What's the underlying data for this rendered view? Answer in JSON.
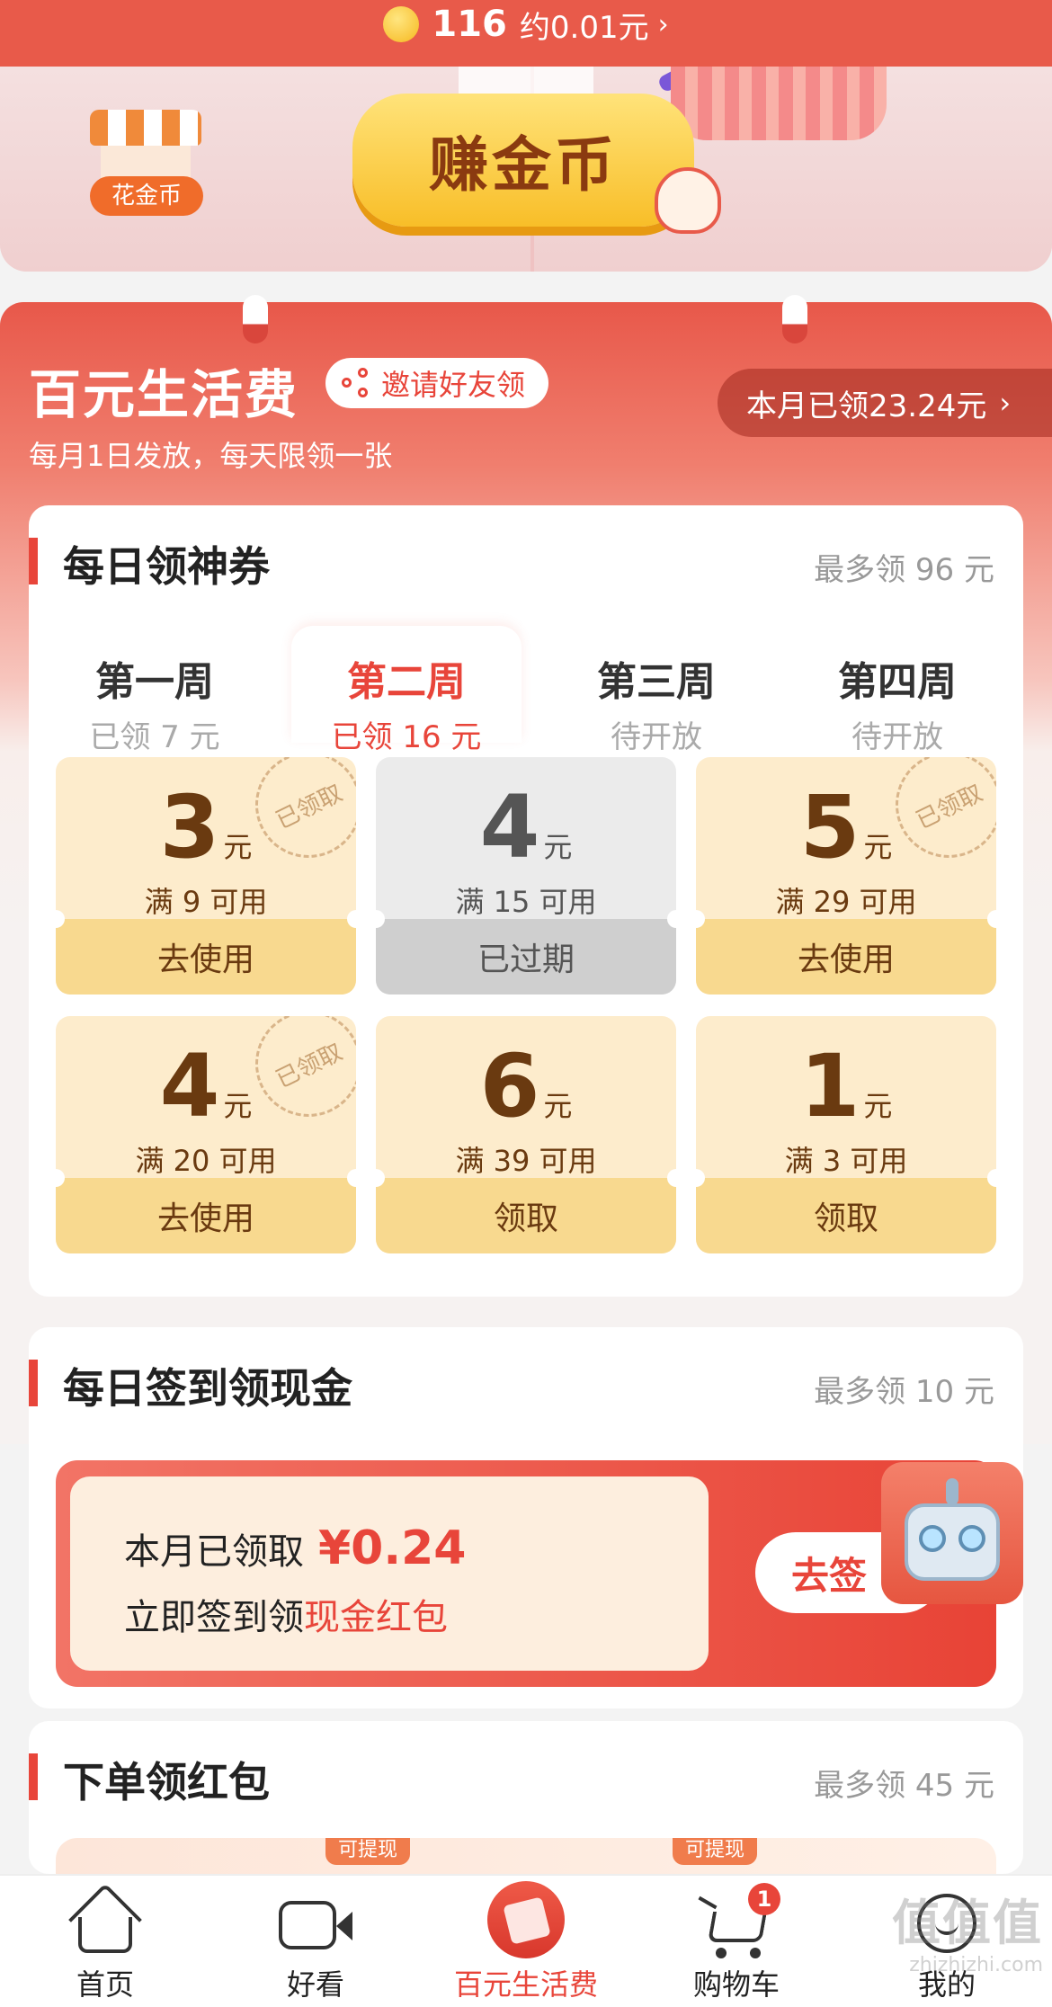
{
  "top_bar": {
    "coin_count": "116",
    "coin_approx": "约0.01元",
    "chevron": "›"
  },
  "banner": {
    "shop_label": "花金币",
    "earn_button": "赚金币",
    "hand_icon": "pointing-hand-icon"
  },
  "allowance": {
    "title": "百元生活费",
    "invite_label": "邀请好友领",
    "subtitle": "每月1日发放，每天限领一张",
    "month_claimed": "本月已领23.24元",
    "month_chevron": "›"
  },
  "daily_coupon": {
    "title": "每日领神券",
    "max": "最多领 96 元",
    "tabs": [
      {
        "name": "第一周",
        "sub": "已领 7 元",
        "active": false
      },
      {
        "name": "第二周",
        "sub": "已领 16 元",
        "active": true
      },
      {
        "name": "第三周",
        "sub": "待开放",
        "active": false
      },
      {
        "name": "第四周",
        "sub": "待开放",
        "active": false
      }
    ],
    "coupons": [
      {
        "amount": "3",
        "unit": "元",
        "cond": "满 9 可用",
        "button": "去使用",
        "stamp": "已领取",
        "state": "claimed"
      },
      {
        "amount": "4",
        "unit": "元",
        "cond": "满 15 可用",
        "button": "已过期",
        "stamp": "",
        "state": "expired"
      },
      {
        "amount": "5",
        "unit": "元",
        "cond": "满 29 可用",
        "button": "去使用",
        "stamp": "已领取",
        "state": "claimed"
      },
      {
        "amount": "4",
        "unit": "元",
        "cond": "满 20 可用",
        "button": "去使用",
        "stamp": "已领取",
        "state": "claimed"
      },
      {
        "amount": "6",
        "unit": "元",
        "cond": "满 39 可用",
        "button": "领取",
        "stamp": "",
        "state": "available"
      },
      {
        "amount": "1",
        "unit": "元",
        "cond": "满 3 可用",
        "button": "领取",
        "stamp": "",
        "state": "available"
      }
    ]
  },
  "signin": {
    "title": "每日签到领现金",
    "max": "最多领 10 元",
    "month_label": "本月已领取",
    "month_amount": "¥0.24",
    "line2_prefix": "立即签到领",
    "line2_highlight": "现金红包",
    "button": "去签"
  },
  "order": {
    "title": "下单领红包",
    "max": "最多领 45 元",
    "tag": "可提现"
  },
  "bottom_nav": [
    {
      "label": "首页",
      "icon": "home-icon",
      "active": false
    },
    {
      "label": "好看",
      "icon": "video-icon",
      "active": false
    },
    {
      "label": "百元生活费",
      "icon": "allowance-icon",
      "active": true
    },
    {
      "label": "购物车",
      "icon": "cart-icon",
      "active": false,
      "badge": "1"
    },
    {
      "label": "我的",
      "icon": "profile-icon",
      "active": false
    }
  ],
  "watermark": {
    "brand": "值值值",
    "url": "zhizhizhi.com"
  },
  "colors": {
    "accent": "#e8453a",
    "coupon_bg": "#fdeccc",
    "coupon_btn": "#f8d98f"
  }
}
